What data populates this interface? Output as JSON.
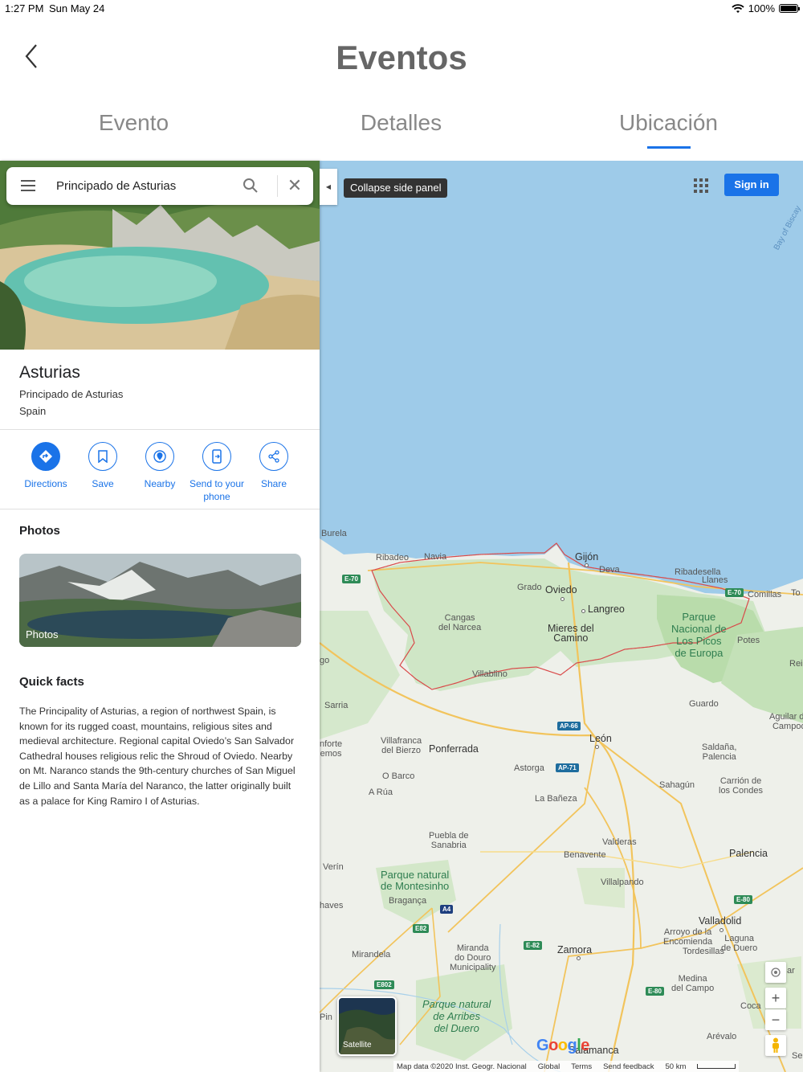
{
  "status": {
    "time": "1:27 PM",
    "date": "Sun May 24",
    "battery": "100%"
  },
  "header": {
    "title": "Eventos",
    "tabs": [
      "Evento",
      "Detalles",
      "Ubicación"
    ],
    "active_tab": "Ubicación"
  },
  "search": {
    "query": "Principado de Asturias"
  },
  "place": {
    "name": "Asturias",
    "region": "Principado de Asturias",
    "country": "Spain"
  },
  "actions": [
    {
      "label": "Directions",
      "icon": "directions-icon"
    },
    {
      "label": "Save",
      "icon": "bookmark-icon"
    },
    {
      "label": "Nearby",
      "icon": "nearby-icon"
    },
    {
      "label": "Send to your phone",
      "icon": "send-to-phone-icon"
    },
    {
      "label": "Share",
      "icon": "share-icon"
    }
  ],
  "photos": {
    "heading": "Photos",
    "label": "Photos"
  },
  "quick_facts": {
    "heading": "Quick facts",
    "text": "The Principality of Asturias, a region of northwest Spain, is known for its rugged coast, mountains, religious sites and medieval architecture. Regional capital Oviedo’s San Salvador Cathedral houses religious relic the Shroud of Oviedo. Nearby on Mt. Naranco stands the 9th-century churches of San Miguel de Lillo and Santa María del Naranco, the latter originally built as a palace for King Ramiro I of Asturias."
  },
  "map": {
    "tooltip": "Collapse side panel",
    "signin": "Sign in",
    "satellite": "Satellite",
    "sea_label": "Bay of Biscay",
    "attribution": [
      "Map data ©2020 Inst. Geogr. Nacional",
      "Global",
      "Terms",
      "Send feedback",
      "50 km"
    ],
    "logo": "Google",
    "labels": {
      "burela": "Burela",
      "ribadeo": "Ribadeo",
      "navia": "Navia",
      "gijon": "Gijón",
      "deva": "Deva",
      "ribadesella": "Ribadesella",
      "llanes": "Llanes",
      "comillas": "Comillas",
      "to": "To",
      "grado": "Grado",
      "oviedo": "Oviedo",
      "langreo": "Langreo",
      "cangas": "Cangas\ndel Narcea",
      "mieres": "Mieres del\nCamino",
      "picos": "Parque\nNacional de\nLos Picos\nde Europa",
      "potes": "Potes",
      "rei": "Rei",
      "go": "go",
      "villablino": "Villablino",
      "sarria": "Sarria",
      "guardo": "Guardo",
      "aguilar": "Aguilar de\nCampoo",
      "leon": "León",
      "forte": "nforte\nemos",
      "villafranca": "Villafranca\ndel Bierzo",
      "ponferrada": "Ponferrada",
      "saldana": "Saldaña,\nPalencia",
      "astorga": "Astorga",
      "obarco": "O Barco",
      "sahagun": "Sahagún",
      "carrion": "Carrión de\nlos Condes",
      "arua": "A Rúa",
      "labaneza": "La Bañeza",
      "puebla": "Puebla de\nSanabria",
      "valderas": "Valderas",
      "benavente": "Benavente",
      "palencia": "Palencia",
      "verin": "Verín",
      "montesinho": "Parque natural\nde Montesinho",
      "villalpando": "Villalpando",
      "chaves": "haves",
      "braganca": "Bragança",
      "valladolid": "Valladolid",
      "arroyo": "Arroyo de la\nEncomienda",
      "laguna": "Laguna\nde Duero",
      "tordesillas": "Tordesillas",
      "mirandela": "Mirandela",
      "miranda": "Miranda\ndo Douro\nMunicipality",
      "zamora": "Zamora",
      "ar": "ar",
      "medina": "Medina\ndel Campo",
      "arribes": "Parque natural\nde Arribes\ndel Duero",
      "coca": "Coca",
      "pin": "Pin",
      "arevalo": "Arévalo",
      "salamanca": "Salamanca",
      "se": "Se"
    },
    "roads": [
      "E-70",
      "E-70",
      "AP-66",
      "AP-71",
      "A4",
      "E82",
      "E-82",
      "E802",
      "E-80",
      "E-80"
    ]
  },
  "colors": {
    "accent": "#1a73e8",
    "sea": "#9ecbe9",
    "land": "#eef0ea",
    "green": "#c8e6c9",
    "border": "#d94a4a"
  }
}
